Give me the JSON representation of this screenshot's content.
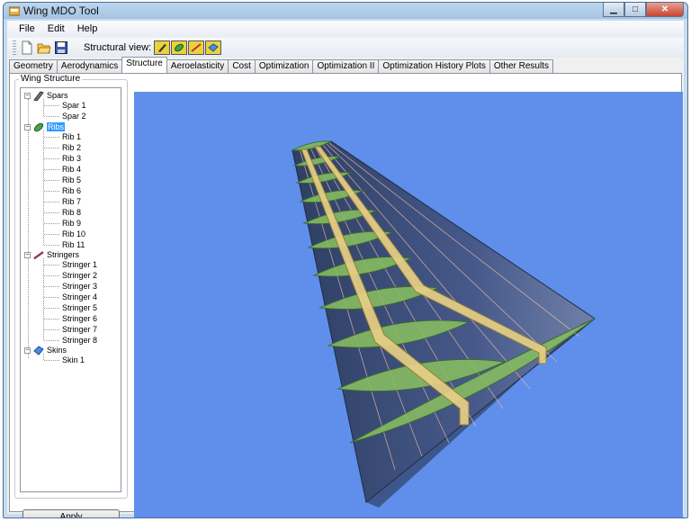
{
  "window": {
    "title": "Wing MDO Tool"
  },
  "menu": [
    "File",
    "Edit",
    "Help"
  ],
  "toolbar": {
    "structural_view_label": "Structural view:"
  },
  "tabs": [
    "Geometry",
    "Aerodynamics",
    "Structure",
    "Aeroelasticity",
    "Cost",
    "Optimization",
    "Optimization II",
    "Optimization History Plots",
    "Other Results"
  ],
  "active_tab": "Structure",
  "panel": {
    "group_title": "Wing Structure",
    "apply_label": "Apply",
    "tree": {
      "spars": {
        "label": "Spars",
        "children": [
          "Spar 1",
          "Spar 2"
        ]
      },
      "ribs": {
        "label": "Ribs",
        "children": [
          "Rib 1",
          "Rib 2",
          "Rib 3",
          "Rib 4",
          "Rib 5",
          "Rib 6",
          "Rib 7",
          "Rib 8",
          "Rib 9",
          "Rib 10",
          "Rib 11"
        ]
      },
      "stringers": {
        "label": "Stringers",
        "children": [
          "Stringer 1",
          "Stringer 2",
          "Stringer 3",
          "Stringer 4",
          "Stringer 5",
          "Stringer 6",
          "Stringer 7",
          "Stringer 8"
        ]
      },
      "skins": {
        "label": "Skins",
        "children": [
          "Skin 1"
        ]
      }
    },
    "selected_node": "Ribs"
  },
  "colors": {
    "viewport_bg": "#5f8fea",
    "wing_skin": "#3a4f7a",
    "rib_green": "#8fbf6a",
    "spar_tan": "#e6cf86",
    "stringer": "#e8b8a8",
    "selection": "#3399ff"
  }
}
